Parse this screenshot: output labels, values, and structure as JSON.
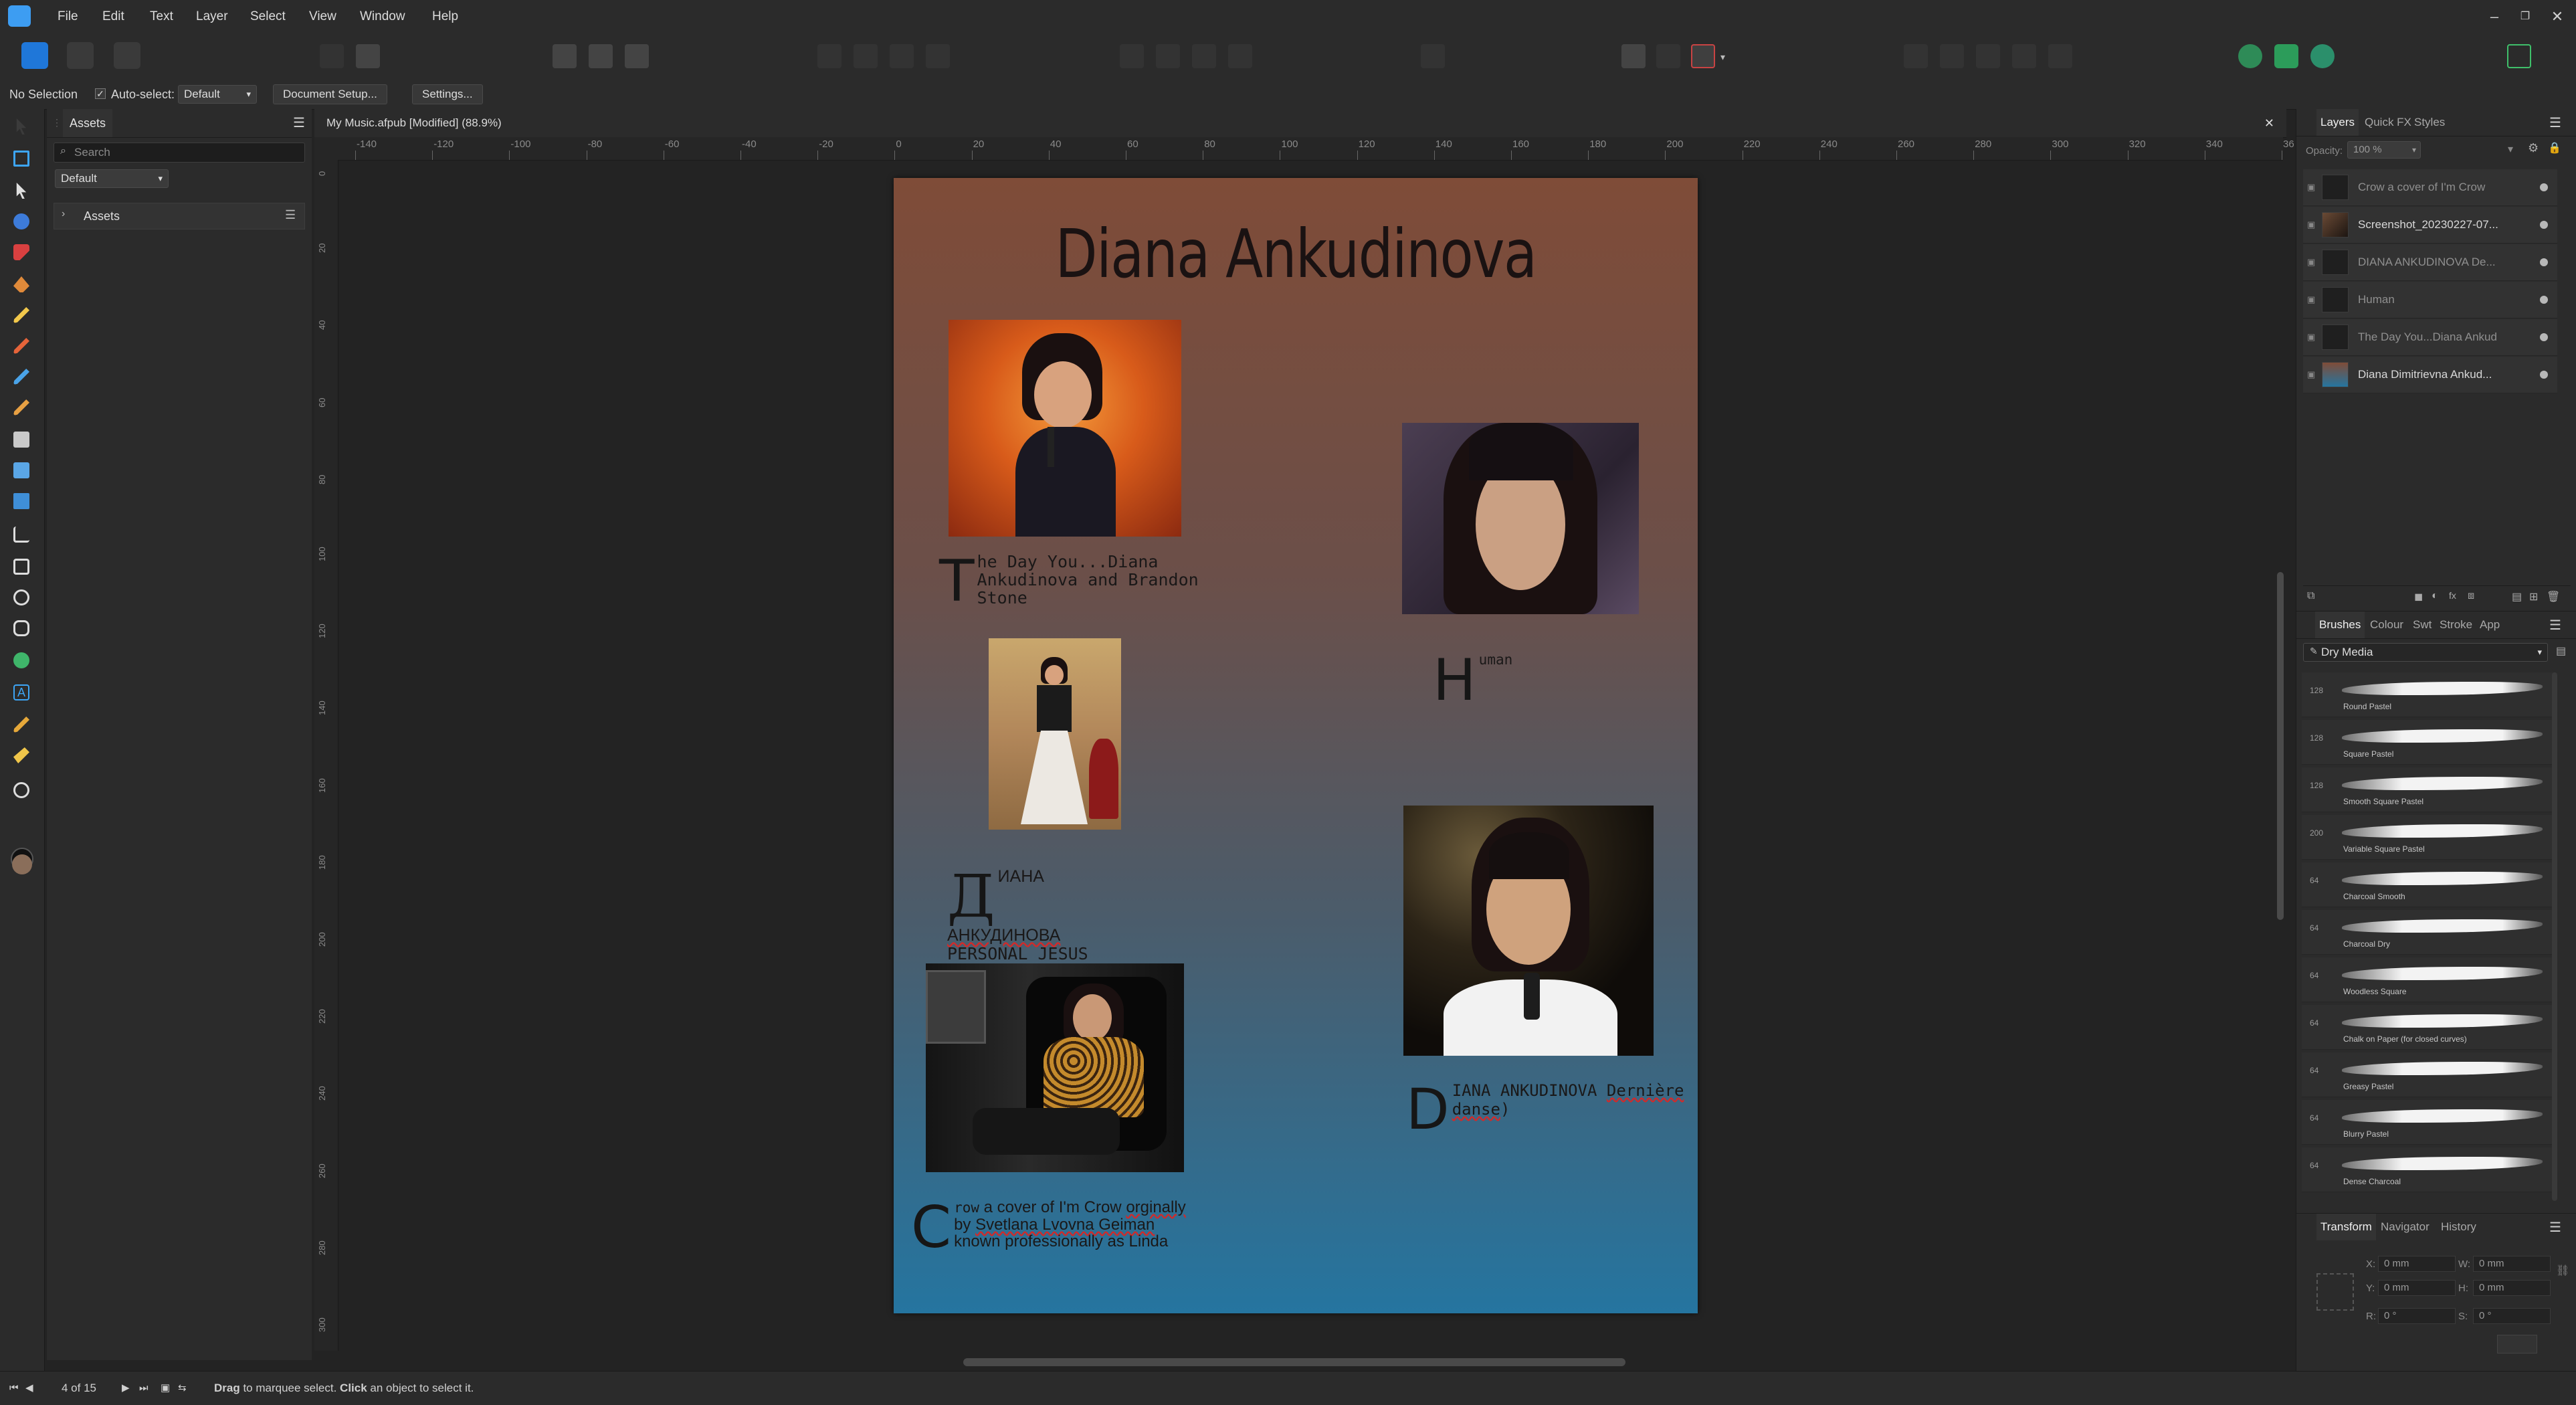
{
  "menu": {
    "items": [
      "File",
      "Edit",
      "Text",
      "Layer",
      "Select",
      "View",
      "Window",
      "Help"
    ]
  },
  "context": {
    "selection": "No Selection",
    "auto_select_label": "Auto-select:",
    "auto_select_value": "Default",
    "document_setup": "Document Setup...",
    "settings": "Settings..."
  },
  "assets": {
    "tab": "Assets",
    "search_placeholder": "Search",
    "category_select": "Default",
    "category": "Assets"
  },
  "document": {
    "tab_title": "My Music.afpub [Modified] (88.9%)",
    "ruler_h": [
      "-140",
      "-120",
      "-100",
      "-80",
      "-60",
      "-40",
      "-20",
      "0",
      "20",
      "40",
      "60",
      "80",
      "100",
      "120",
      "140",
      "160",
      "180",
      "200",
      "220",
      "240",
      "260",
      "280",
      "300",
      "320",
      "340",
      "36"
    ],
    "ruler_v": [
      "0",
      "20",
      "40",
      "60",
      "80",
      "100",
      "120",
      "140",
      "160",
      "180",
      "200",
      "220",
      "240",
      "260",
      "280",
      "300"
    ]
  },
  "page": {
    "title": "Diana Ankudinova",
    "caption1": {
      "cap": "T",
      "text": "he Day You...Diana Ankudinova and Brandon Stone"
    },
    "caption2": {
      "cap": "H",
      "text": "uman"
    },
    "caption3": {
      "cap": "Д",
      "line1": "ИАНА",
      "line2": "АНКУДИНОВА",
      "line3": "PERSONAL JESUS"
    },
    "caption4": {
      "cap": "D",
      "text_a": "IANA ANKUDINOVA ",
      "text_b": "Dernière",
      "text_c": "danse",
      "text_d": ")"
    },
    "caption5": {
      "cap": "C",
      "a": "row",
      "b": " a cover of I'm Crow ",
      "c": "orginally",
      "d": "by ",
      "e": "Svetlana Lvovna Geiman",
      "f": "known professionally as Linda"
    }
  },
  "layers": {
    "tabs": [
      "Layers",
      "Quick FX",
      "Styles"
    ],
    "opacity_label": "Opacity:",
    "opacity_value": "100 %",
    "items": [
      {
        "name": "Crow a cover of I'm Crow",
        "dim": true
      },
      {
        "name": "Screenshot_20230227-07...",
        "dim": false
      },
      {
        "name": "DIANA ANKUDINOVA De...",
        "dim": true
      },
      {
        "name": "Human",
        "dim": true
      },
      {
        "name": "The Day You...Diana Ankud",
        "dim": true
      },
      {
        "name": "Diana Dimitrievna Ankud...",
        "dim": false
      }
    ]
  },
  "brushes": {
    "tabs": [
      "Brushes",
      "Colour",
      "Swt",
      "Stroke",
      "App"
    ],
    "category": "Dry Media",
    "items": [
      {
        "size": "128",
        "name": "Round Pastel"
      },
      {
        "size": "128",
        "name": "Square Pastel"
      },
      {
        "size": "128",
        "name": "Smooth Square Pastel"
      },
      {
        "size": "200",
        "name": "Variable Square Pastel"
      },
      {
        "size": "64",
        "name": "Charcoal Smooth"
      },
      {
        "size": "64",
        "name": "Charcoal Dry"
      },
      {
        "size": "64",
        "name": "Woodless Square"
      },
      {
        "size": "64",
        "name": "Chalk on Paper (for closed curves)"
      },
      {
        "size": "64",
        "name": "Greasy Pastel"
      },
      {
        "size": "64",
        "name": "Blurry Pastel"
      },
      {
        "size": "64",
        "name": "Dense Charcoal"
      }
    ]
  },
  "transform": {
    "tabs": [
      "Transform",
      "Navigator",
      "History"
    ],
    "x_label": "X:",
    "x": "0 mm",
    "y_label": "Y:",
    "y": "0 mm",
    "w_label": "W:",
    "w": "0 mm",
    "h_label": "H:",
    "h": "0 mm",
    "r_label": "R:",
    "r": "0 °",
    "s_label": "S:",
    "s": "0 °"
  },
  "status": {
    "page": "4 of 15",
    "hint_bold1": "Drag",
    "hint1": " to marquee select. ",
    "hint_bold2": "Click",
    "hint2": " an object to select it."
  },
  "colors": {
    "accent": "#1f77d9",
    "page_top": "#7f4c38",
    "page_bottom": "#2575a0"
  }
}
